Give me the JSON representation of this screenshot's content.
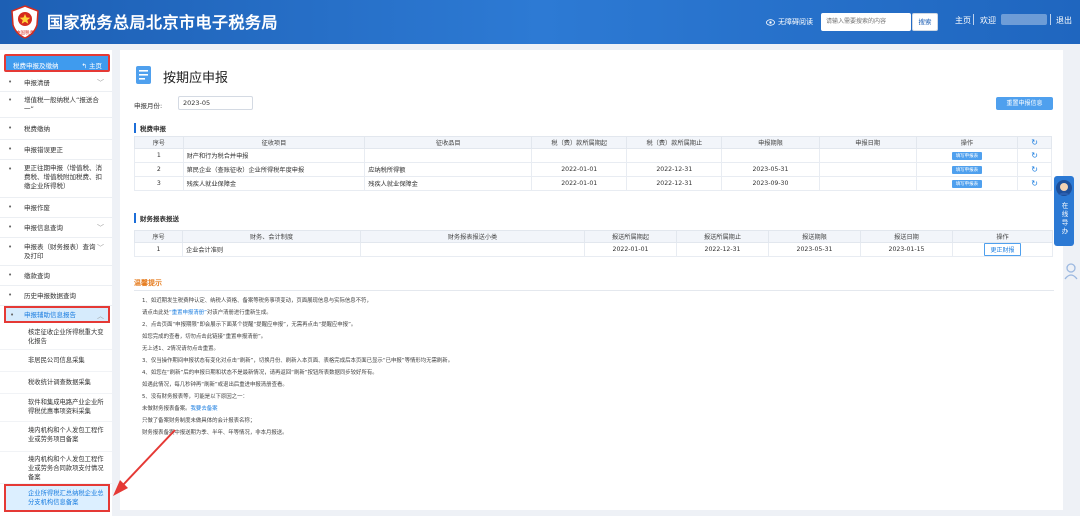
{
  "header": {
    "site_title": "国家税务总局北京市电子税务局",
    "logo_caption": "中国税务",
    "accessibility": "无障碍阅读",
    "search_placeholder": "请输入需要搜索的内容",
    "search_button": "搜索",
    "home_link": "主页",
    "welcome": "欢迎",
    "logout": "退出",
    "brand_color": "#2470c8"
  },
  "sidebar": {
    "header_label": "税费申报及缴纳",
    "home_label": "主页",
    "menu": [
      {
        "label": "申报清册",
        "chev": "﹀"
      },
      {
        "label": "增值税一般纳税人“报送合一”",
        "chev": ""
      },
      {
        "label": "税费缴纳",
        "chev": ""
      },
      {
        "label": "申报错误更正",
        "chev": ""
      },
      {
        "label": "更正往期申报（增值税、消费税、增值税附加税费、扣缴企业所得税）",
        "chev": ""
      },
      {
        "label": "申报作废",
        "chev": ""
      },
      {
        "label": "申报信息查询",
        "chev": "﹀"
      },
      {
        "label": "申报表（财务报表）查询及打印",
        "chev": "﹀"
      },
      {
        "label": "缴款查询",
        "chev": ""
      },
      {
        "label": "历史申报数据查询",
        "chev": ""
      },
      {
        "label": "申报辅助信息报告",
        "chev": "︿"
      }
    ],
    "submenu": [
      "核定征收企业所得税重大变化报告",
      "非居民公司信息采集",
      "税收统计调查数据采集",
      "软件和集成电路产业企业所得税优惠事项资料采集",
      "境内机构和个人发包工程作业或劳务项目备案",
      "境内机构和个人发包工程作业或劳务合同款项支付情况备案",
      "企业所得税汇总纳税企业总分支机构信息备案"
    ]
  },
  "main": {
    "title": "按期应申报",
    "period_label": "申报月份:",
    "period_value": "2023-05",
    "refresh_button": "重置申报信息",
    "tax_section": "税费申报",
    "tax_headers": [
      "序号",
      "征收项目",
      "征收品目",
      "税（费）款所属期起",
      "税（费）款所属期止",
      "申报期限",
      "申报日期",
      "操作",
      "↻"
    ],
    "tax_rows": [
      {
        "no": "1",
        "item": "财产和行为税合并申报",
        "sub": "",
        "start": "",
        "end": "",
        "deadline": "",
        "date": "",
        "op": "填写申报表"
      },
      {
        "no": "2",
        "item": "第民企业（查账征收）企业所得税年度申报",
        "sub": "应纳税所得额",
        "start": "2022-01-01",
        "end": "2022-12-31",
        "deadline": "2023-05-31",
        "date": "",
        "op": "填写申报表"
      },
      {
        "no": "3",
        "item": "残疾人就业保障金",
        "sub": "残疾人就业保障金",
        "start": "2022-01-01",
        "end": "2022-12-31",
        "deadline": "2023-09-30",
        "date": "",
        "op": "填写申报表"
      }
    ],
    "fin_section": "财务报表报送",
    "fin_headers": [
      "序号",
      "财务、会计制度",
      "财务报表报送小类",
      "报送所属期起",
      "报送所属期止",
      "报送期限",
      "报送日期",
      "操作"
    ],
    "fin_rows": [
      {
        "no": "1",
        "system": "企业会计准则",
        "type": "",
        "start": "2022-01-01",
        "end": "2022-12-31",
        "deadline": "2023-05-31",
        "date": "2023-01-15",
        "op": "更正财报"
      }
    ],
    "tips_title": "温馨提示",
    "tips": [
      {
        "text": "1、如近期发生税费种认定、纳税人资格、备案等税务事项变动，页面展现信息与实际信息不符，",
        "blue": ""
      },
      {
        "text": "请点击此处",
        "blue": "“重置申报清册”",
        "after": "对该户清册进行重新生成。"
      },
      {
        "text": "2、点击页面“申报期限”即会展示下面某个提醒“提醒应申报”，无需再点击“提醒应申报”。",
        "blue": ""
      },
      {
        "text": "如您完成的查看，切勿点击此链接“重置申报清册”。",
        "blue": ""
      },
      {
        "text": "无上述1、2情况请勿点击重置。",
        "blue": ""
      },
      {
        "text": "3、仅当操作期间申报状态有变化对点击“刷新”，切换月份、刷新入本页面、表格完成后本页面已显示“已申报”等情形均无需刷新。",
        "blue": ""
      },
      {
        "text": "4、如您在“刷新”后的申报日期和状态不是最新情况，请再返回“刷新”按钮所表数据同步较好所有。",
        "blue": ""
      },
      {
        "text": "如遇此情况，每几秒钟再“刷新”或退出后重进申报清册查看。",
        "blue": ""
      },
      {
        "text": "5、没有财务报表等，可能是以下原因之一：",
        "blue": ""
      },
      {
        "text": "未做财务报表备案。",
        "blue": "我要去备案",
        "after": ""
      },
      {
        "text": "只做了备案财务制度未做具体的会计报表名称；",
        "blue": ""
      },
      {
        "text": "财务报表备案中报送期为季、半年、年等情况，非本月报送。",
        "blue": ""
      }
    ]
  },
  "float_widget": {
    "label": "在线导办"
  }
}
